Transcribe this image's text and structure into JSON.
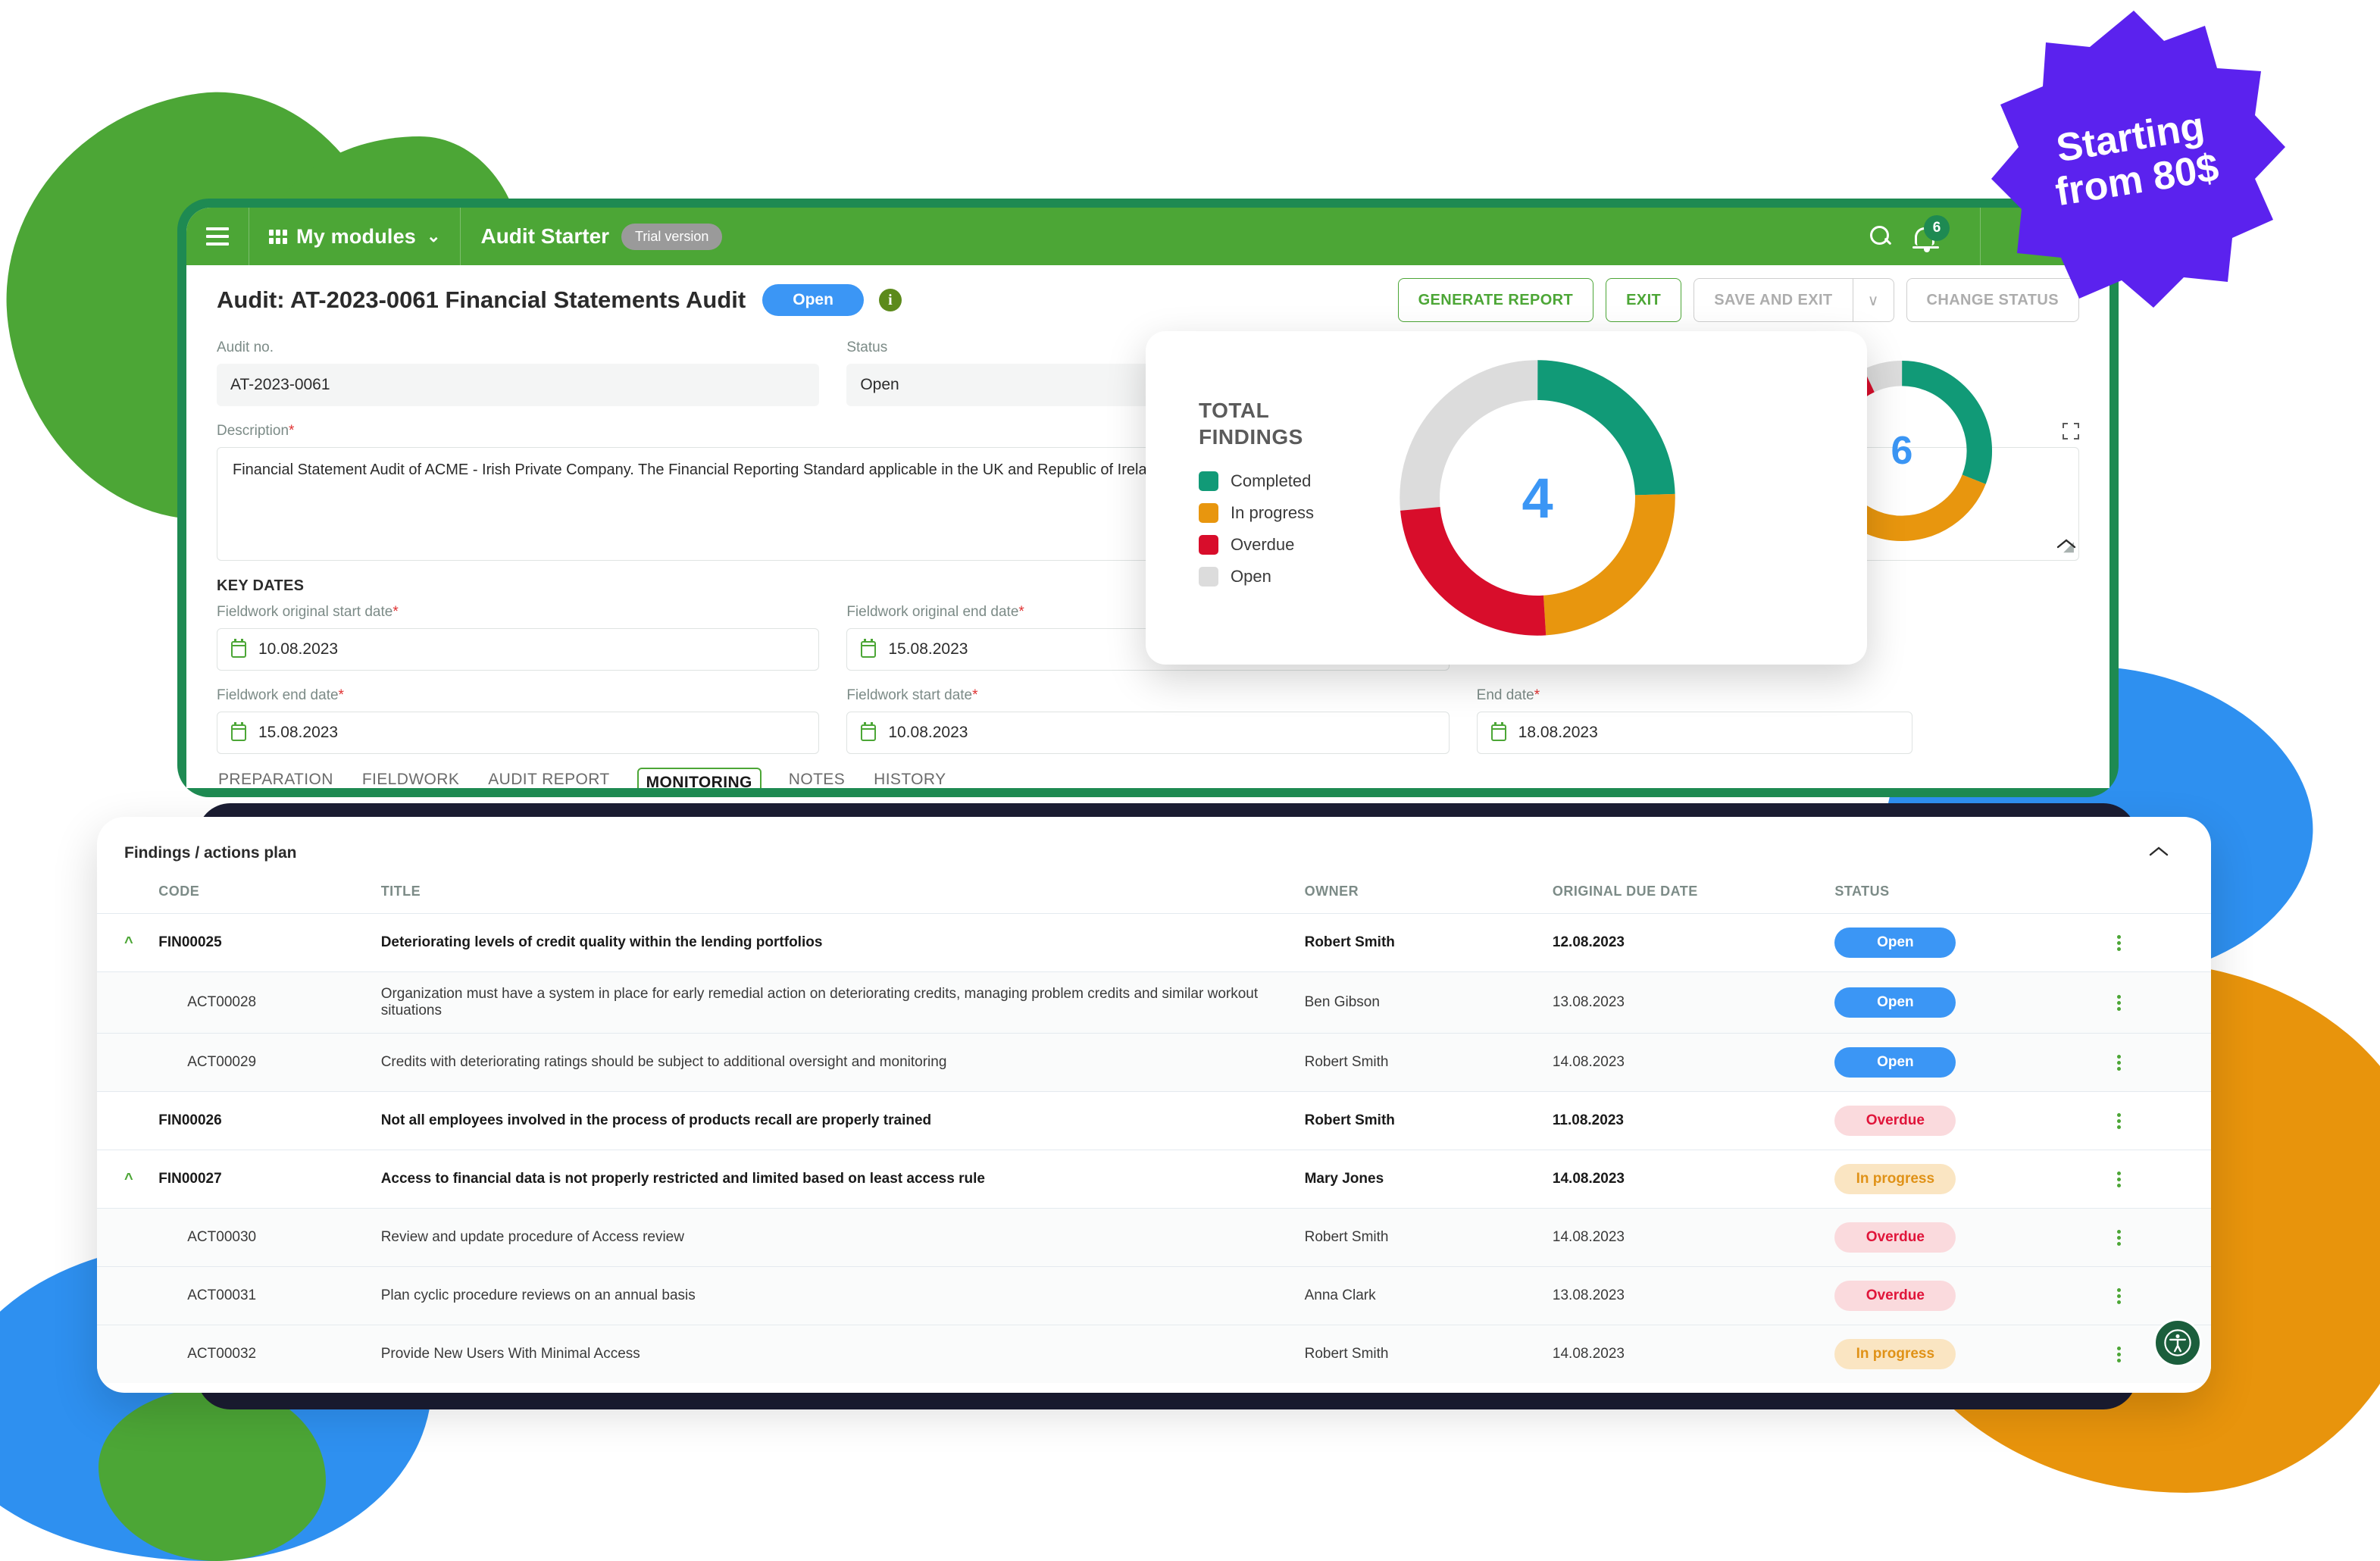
{
  "promo": {
    "line1": "Starting",
    "line2": "from 80$"
  },
  "topbar": {
    "menu_icon": "hamburger-icon",
    "modules_label": "My modules",
    "app_name": "Audit Starter",
    "trial_badge": "Trial version",
    "search_icon": "search-icon",
    "bell_icon": "bell-icon",
    "notification_count": "6"
  },
  "header": {
    "title": "Audit: AT-2023-0061 Financial Statements Audit",
    "status_pill": "Open",
    "info_icon": "i",
    "actions": {
      "generate_report": "GENERATE REPORT",
      "exit": "EXIT",
      "save_and_exit": "SAVE AND EXIT",
      "save_caret": "∨",
      "change_status": "CHANGE STATUS"
    }
  },
  "form": {
    "audit_no_label": "Audit no.",
    "audit_no_value": "AT-2023-0061",
    "status_label": "Status",
    "status_value": "Open",
    "description_label": "Description",
    "description_value": "Financial Statement Audit of ACME - Irish Private Company. The Financial Reporting Standard applicable in the UK and Republic of Ireland is applied by the company.",
    "key_dates_title": "KEY DATES",
    "dates": [
      {
        "label": "Fieldwork original start date",
        "value": "10.08.2023",
        "required": true
      },
      {
        "label": "Fieldwork original end date",
        "value": "15.08.2023",
        "required": true
      },
      {
        "label": "",
        "value": "",
        "required": false
      },
      {
        "label": "Fieldwork end date",
        "value": "15.08.2023",
        "required": true
      },
      {
        "label": "Fieldwork start date",
        "value": "10.08.2023",
        "required": true
      },
      {
        "label": "End date",
        "value": "18.08.2023",
        "required": true
      }
    ]
  },
  "tabs": [
    {
      "label": "PREPARATION",
      "active": false
    },
    {
      "label": "FIELDWORK",
      "active": false
    },
    {
      "label": "AUDIT REPORT",
      "active": false
    },
    {
      "label": "MONITORING",
      "active": true
    },
    {
      "label": "NOTES",
      "active": false
    },
    {
      "label": "HISTORY",
      "active": false
    }
  ],
  "findings": {
    "title": "Findings / actions plan",
    "columns": [
      "CODE",
      "TITLE",
      "OWNER",
      "ORIGINAL DUE DATE",
      "STATUS"
    ],
    "rows": [
      {
        "type": "finding",
        "expandable": true,
        "code": "FIN00025",
        "title": "Deteriorating levels of credit quality within the lending portfolios",
        "owner": "Robert Smith",
        "due": "12.08.2023",
        "status": "Open",
        "status_kind": "open"
      },
      {
        "type": "action",
        "expandable": false,
        "code": "ACT00028",
        "title": "Organization must have a system in place for early remedial action on deteriorating credits, managing problem credits and similar workout situations",
        "owner": "Ben Gibson",
        "due": "13.08.2023",
        "status": "Open",
        "status_kind": "open"
      },
      {
        "type": "action",
        "expandable": false,
        "code": "ACT00029",
        "title": "Credits with deteriorating ratings should be subject to additional oversight and monitoring",
        "owner": "Robert Smith",
        "due": "14.08.2023",
        "status": "Open",
        "status_kind": "open"
      },
      {
        "type": "finding",
        "expandable": false,
        "code": "FIN00026",
        "title": "Not all employees involved in the process of products recall are properly trained",
        "owner": "Robert Smith",
        "due": "11.08.2023",
        "status": "Overdue",
        "status_kind": "overdue"
      },
      {
        "type": "finding",
        "expandable": true,
        "code": "FIN00027",
        "title": "Access to financial data is not properly restricted and limited based on least access rule",
        "owner": "Mary Jones",
        "due": "14.08.2023",
        "status": "In progress",
        "status_kind": "progress"
      },
      {
        "type": "action",
        "expandable": false,
        "code": "ACT00030",
        "title": "Review and update procedure of Access review",
        "owner": "Robert Smith",
        "due": "14.08.2023",
        "status": "Overdue",
        "status_kind": "overdue"
      },
      {
        "type": "action",
        "expandable": false,
        "code": "ACT00031",
        "title": "Plan cyclic procedure reviews on an annual basis",
        "owner": "Anna Clark",
        "due": "13.08.2023",
        "status": "Overdue",
        "status_kind": "overdue"
      },
      {
        "type": "action",
        "expandable": false,
        "code": "ACT00032",
        "title": "Provide New Users With Minimal Access",
        "owner": "Robert Smith",
        "due": "14.08.2023",
        "status": "In progress",
        "status_kind": "progress"
      }
    ]
  },
  "chart_data": [
    {
      "type": "pie",
      "title": "TOTAL FINDINGS",
      "center_value": "4",
      "categories": [
        "Completed",
        "In progress",
        "Overdue",
        "Open"
      ],
      "values": [
        1,
        1,
        1,
        1
      ],
      "colors": [
        "#119A77",
        "#E8960E",
        "#D80D2B",
        "#DCDCDC"
      ],
      "legend_position": "left",
      "donut": true
    },
    {
      "type": "pie",
      "title": "",
      "center_value": "6",
      "categories": [
        "Completed",
        "In progress",
        "Overdue",
        "Open"
      ],
      "values": [
        2,
        2,
        2,
        0.4
      ],
      "colors": [
        "#119A77",
        "#E8960E",
        "#D80D2B",
        "#DCDCDC"
      ],
      "legend_position": "none",
      "donut": true
    }
  ],
  "a11y_icon": "accessibility-icon"
}
